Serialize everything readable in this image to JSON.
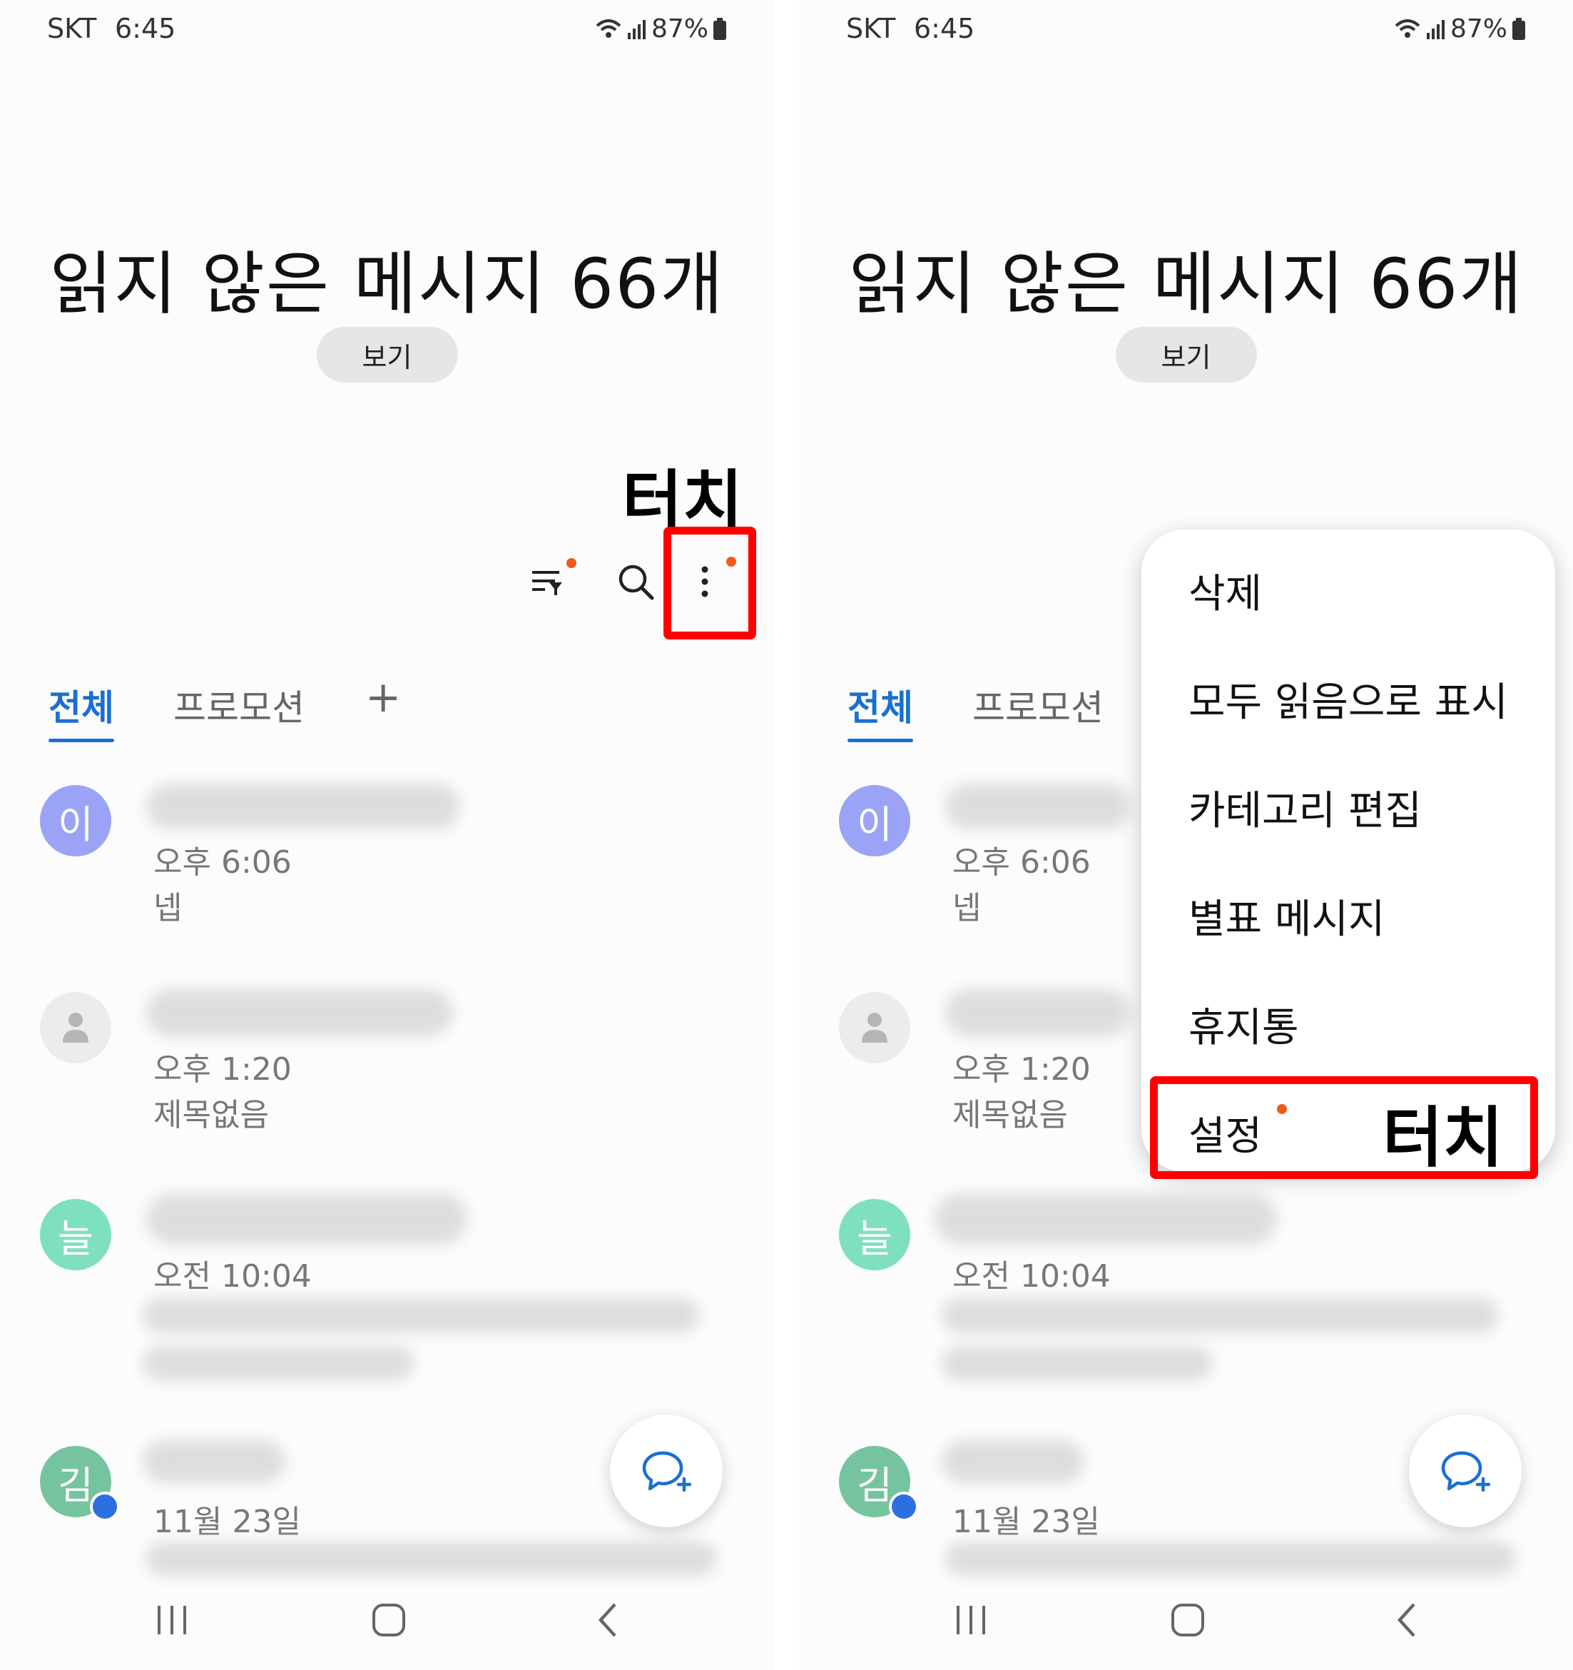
{
  "status_bar": {
    "carrier": "SKT",
    "time": "6:45",
    "battery": "87%"
  },
  "header": {
    "title": "읽지 않은 메시지 66개",
    "view_button": "보기"
  },
  "toolbar": {
    "icons": [
      "filter-icon",
      "search-icon",
      "more-options-icon"
    ]
  },
  "tabs": {
    "all": "전체",
    "promotion": "프로모션",
    "add": "+"
  },
  "conversations": [
    {
      "avatar_initial": "이",
      "avatar_color": "#9aa3f5",
      "time": "오후 6:06",
      "preview": "넵"
    },
    {
      "avatar_initial": "",
      "avatar_color": "#ececec",
      "time": "오후 1:20",
      "preview": "제목없음"
    },
    {
      "avatar_initial": "늘",
      "avatar_color": "#7fe0bd",
      "time": "오전 10:04",
      "preview": ""
    },
    {
      "avatar_initial": "김",
      "avatar_color": "#76c3a0",
      "time": "11월 23일",
      "preview": ""
    }
  ],
  "menu": {
    "items": [
      "삭제",
      "모두 읽음으로 표시",
      "카테고리 편집",
      "별표 메시지",
      "휴지통",
      "설정"
    ]
  },
  "annotations": {
    "touch": "터치"
  },
  "colors": {
    "accent": "#1a6fd3",
    "notify_dot": "#f05a1a",
    "highlight": "#ff0000"
  }
}
